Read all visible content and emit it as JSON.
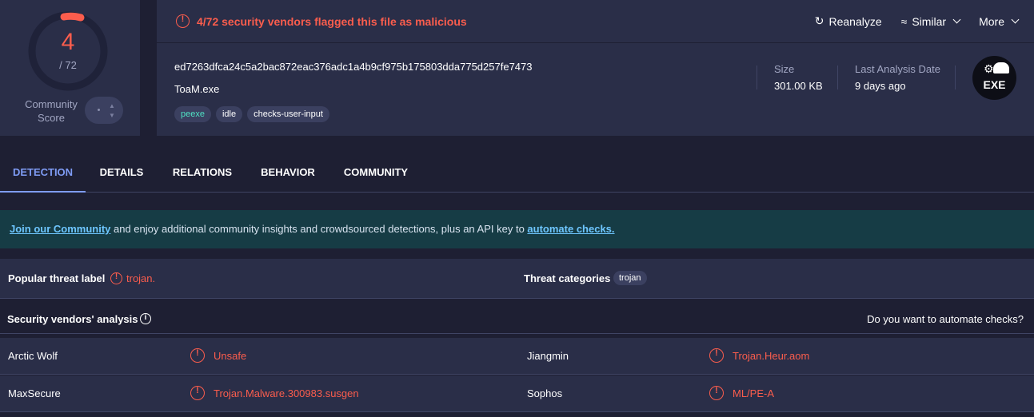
{
  "score": {
    "detected": "4",
    "total": "/ 72",
    "community_label_1": "Community",
    "community_label_2": "Score",
    "ring_color": "#fb5d4d"
  },
  "alert": {
    "text": "4/72 security vendors flagged this file as malicious",
    "color": "#fb5d4d"
  },
  "actions": [
    {
      "label": "Reanalyze",
      "icon": "refresh-icon"
    },
    {
      "label": "Similar",
      "icon": "similar-icon"
    },
    {
      "label": "More",
      "icon": "chevron-down-icon"
    }
  ],
  "file": {
    "hash": "ed7263dfca24c5a2bac872eac376adc1a4b9cf975b175803dda775d257fe7473",
    "name": "ToaM.exe",
    "tags": [
      "peexe",
      "idle",
      "checks-user-input"
    ],
    "size_label": "Size",
    "size_value": "301.00 KB",
    "date_label": "Last Analysis Date",
    "date_value": "9 days ago",
    "type_badge": "EXE"
  },
  "tabs": [
    "DETECTION",
    "DETAILS",
    "RELATIONS",
    "BEHAVIOR",
    "COMMUNITY"
  ],
  "banner": {
    "link1": "Join our Community",
    "middle": " and enjoy additional community insights and crowdsourced detections, plus an API key to ",
    "link2": "automate checks."
  },
  "threat": {
    "popular_label": "Popular threat label",
    "popular_value": "trojan.",
    "categories_label": "Threat categories",
    "category_tag": "trojan"
  },
  "vendors_header": {
    "title": "Security vendors' analysis",
    "automate": "Do you want to automate checks?"
  },
  "vendors": [
    {
      "left_name": "Arctic Wolf",
      "left_result": "Unsafe",
      "right_name": "Jiangmin",
      "right_result": "Trojan.Heur.aom"
    },
    {
      "left_name": "MaxSecure",
      "left_result": "Trojan.Malware.300983.susgen",
      "right_name": "Sophos",
      "right_result": "ML/PE-A"
    }
  ]
}
